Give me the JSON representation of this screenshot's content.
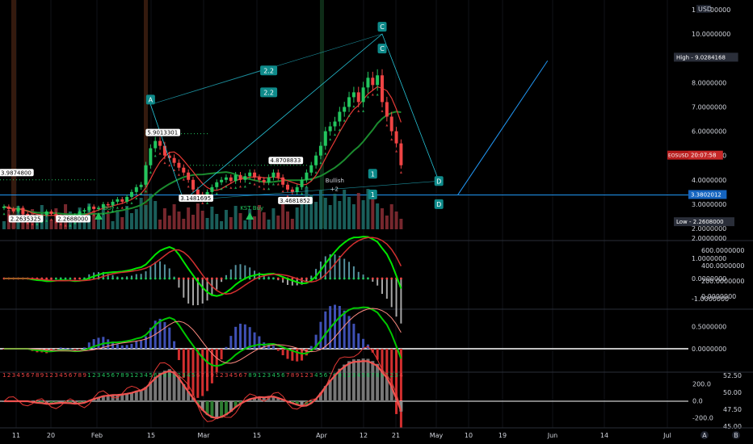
{
  "chart_data": {
    "type": "candlestick",
    "symbol": "EOSUSD",
    "countdown": "20:07:58",
    "currency_label": "USD",
    "x_ticks": [
      "11",
      "20",
      "Feb",
      "15",
      "Mar",
      "15",
      "Apr",
      "12",
      "21",
      "May",
      "10",
      "19",
      "Jun",
      "14",
      "Jul"
    ],
    "price_ticks": [
      "11.0000000",
      "10.0000000",
      "9.0000000",
      "8.0000000",
      "7.0000000",
      "6.0000000",
      "5.0000000",
      "4.0000000",
      "3.0000000",
      "2.0000000"
    ],
    "price_ylim": [
      2.0,
      11.0
    ],
    "price_badges": [
      {
        "label": "High",
        "value": "9.0284168",
        "price": 9.0284168
      },
      {
        "label": "",
        "value": "20:07:58",
        "price": 5.0
      },
      {
        "label": "",
        "value": "3.3802012",
        "price": 3.3802012
      },
      {
        "label": "Low",
        "value": "2.2608000",
        "price": 2.2608
      }
    ],
    "current_symbol_badge": "EOSUSD",
    "close_price": [
      2.9,
      2.8,
      2.7,
      2.85,
      2.6,
      2.45,
      2.4,
      2.5,
      2.55,
      2.7,
      2.6,
      2.5,
      2.4,
      2.35,
      2.45,
      2.55,
      2.7,
      2.75,
      2.9,
      2.8,
      2.85,
      3.0,
      2.95,
      3.1,
      3.2,
      3.1,
      3.3,
      3.5,
      3.7,
      3.8,
      4.6,
      5.3,
      5.6,
      5.4,
      5.0,
      4.9,
      4.7,
      4.5,
      4.3,
      4.0,
      3.6,
      3.4,
      3.3,
      3.5,
      3.7,
      3.9,
      4.0,
      4.1,
      3.95,
      4.2,
      4.0,
      4.15,
      4.3,
      4.1,
      4.0,
      3.9,
      4.1,
      4.3,
      4.1,
      3.8,
      3.6,
      3.5,
      3.7,
      4.0,
      4.3,
      4.6,
      5.0,
      5.4,
      6.0,
      6.2,
      6.4,
      6.8,
      7.0,
      7.4,
      7.6,
      7.2,
      7.8,
      8.2,
      7.9,
      8.3,
      7.2,
      6.6,
      6.0,
      5.5,
      4.6
    ],
    "price_labels": [
      {
        "text": "3.9874800",
        "index": 0,
        "price": 4.25
      },
      {
        "text": "2.2635325",
        "index": 2,
        "price": 2.35
      },
      {
        "text": "2.2688000",
        "index": 12,
        "price": 2.35
      },
      {
        "text": "5.9013301",
        "index": 31,
        "price": 5.9
      },
      {
        "text": "3.1481695",
        "index": 38,
        "price": 3.2
      },
      {
        "text": "4.8708833",
        "index": 57,
        "price": 4.75
      },
      {
        "text": "3.4681852",
        "index": 59,
        "price": 3.1
      }
    ],
    "wave_labels": [
      {
        "text": "A",
        "index": 31,
        "price": 7.3
      },
      {
        "text": "2.2",
        "index": 56,
        "price": 8.5
      },
      {
        "text": "2.2",
        "index": 56,
        "price": 7.6
      },
      {
        "text": "C",
        "index": 80,
        "price": 10.3
      },
      {
        "text": "C",
        "index": 80,
        "price": 9.4
      },
      {
        "text": "1",
        "index": 78,
        "price": 4.25
      },
      {
        "text": "1",
        "index": 78,
        "price": 3.4
      },
      {
        "text": "D",
        "index": 92,
        "price": 3.95
      },
      {
        "text": "D",
        "index": 92,
        "price": 3.0
      }
    ],
    "signals": [
      {
        "text": "Buy",
        "index": 20
      },
      {
        "text": "KST Buy",
        "index": 52
      }
    ],
    "annotations": [
      {
        "text": "Bullish",
        "index": 68,
        "price": 3.9
      },
      {
        "text": "+2",
        "index": 69,
        "price": 3.55
      }
    ],
    "indicator1_ticks": [
      "2.0000000",
      "1.0000000",
      "0.0000000",
      "-1.0000000"
    ],
    "indicator1_right_ticks": [
      "600.0000000",
      "400.0000000",
      "200.0000000",
      "0.0000000"
    ],
    "indicator2_ticks": [
      "0.5000000",
      "0.0000000"
    ],
    "indicator3_ticks": [
      "52.50",
      "200.0",
      "50.00",
      "0.0",
      "47.50",
      "-200.0",
      "45.00"
    ],
    "corner_labels": [
      "A",
      "B"
    ],
    "colors": {
      "up": "#22c55e",
      "down": "#ef4444",
      "teal": "#26a69a",
      "wave_box": "#0e8a8a",
      "line_blue": "#2196f3",
      "background": "#000000"
    }
  }
}
